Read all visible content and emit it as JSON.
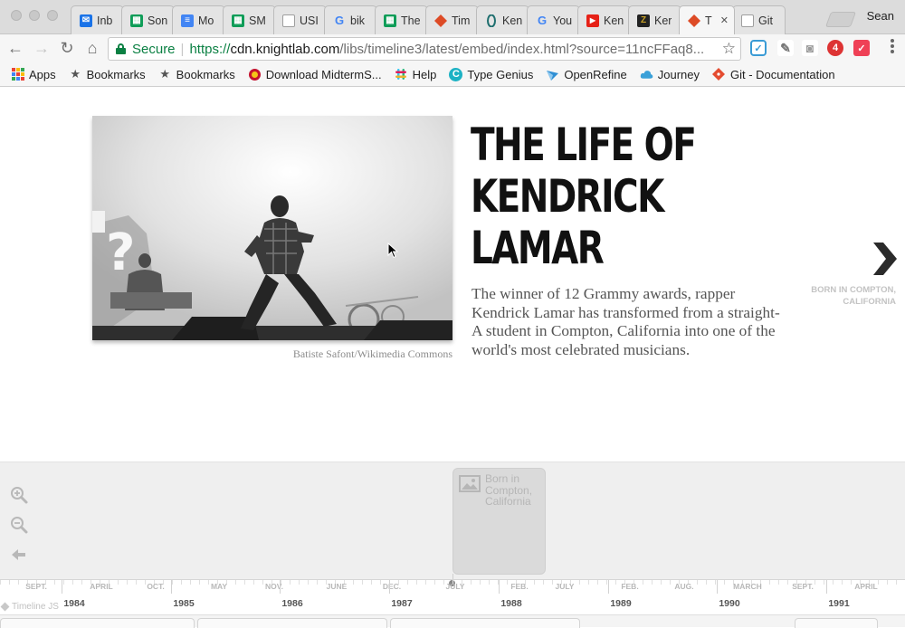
{
  "browser": {
    "tabs": [
      {
        "label": "Inb",
        "icon": "inbox-icon",
        "color": "#1a73e8"
      },
      {
        "label": "Son",
        "icon": "sheets-icon",
        "color": "#0f9d58"
      },
      {
        "label": "Mo",
        "icon": "docs-icon",
        "color": "#4285f4"
      },
      {
        "label": "SM",
        "icon": "sheets-icon",
        "color": "#0f9d58"
      },
      {
        "label": "USI",
        "icon": "page-icon",
        "color": "#9e9e9e"
      },
      {
        "label": "bik",
        "icon": "google-icon",
        "color": "#4285f4"
      },
      {
        "label": "The",
        "icon": "sheets-icon",
        "color": "#0f9d58"
      },
      {
        "label": "Tim",
        "icon": "timeline-icon",
        "color": "#dd4b26"
      },
      {
        "label": "Ken",
        "icon": "knightlab-icon",
        "color": "#1f6f6f"
      },
      {
        "label": "You",
        "icon": "google-icon",
        "color": "#4285f4"
      },
      {
        "label": "Ken",
        "icon": "youtube-icon",
        "color": "#e62117"
      },
      {
        "label": "Ker",
        "icon": "z-icon",
        "color": "#c9a227"
      },
      {
        "label": "T",
        "icon": "timeline-icon",
        "color": "#dd4b26",
        "active": true
      },
      {
        "label": "Git",
        "icon": "page-icon",
        "color": "#9e9e9e"
      }
    ],
    "profile": "Sean",
    "secure_label": "Secure",
    "url_scheme": "https://",
    "url_host": "cdn.knightlab.com",
    "url_path": "/libs/timeline3/latest/embed/index.html?source=11ncFFaq8...",
    "bookmarks": [
      {
        "label": "Apps",
        "icon": "apps-icon"
      },
      {
        "label": "Bookmarks",
        "icon": "star-icon"
      },
      {
        "label": "Bookmarks",
        "icon": "star-icon"
      },
      {
        "label": "Download MidtermS...",
        "icon": "terrapin-icon"
      },
      {
        "label": "Help",
        "icon": "slack-icon"
      },
      {
        "label": "Type Genius",
        "icon": "typegenius-icon"
      },
      {
        "label": "OpenRefine",
        "icon": "openrefine-icon"
      },
      {
        "label": "Journey",
        "icon": "cloud-icon"
      },
      {
        "label": "Git - Documentation",
        "icon": "git-icon"
      }
    ]
  },
  "slide": {
    "headline_line1": "THE LIFE OF",
    "headline_line2": "KENDRICK",
    "headline_line3": "LAMAR",
    "description": "The winner of 12 Grammy awards, rapper Kendrick Lamar has transformed from a straight-A student in Compton, California into one of the world's most celebrated musicians.",
    "photo_credit": "Batiste Safont/Wikimedia Commons",
    "next_label": "BORN IN COMPTON, CALIFORNIA"
  },
  "timeline": {
    "marker_text": "Born in Compton, California",
    "credit": "Timeline JS",
    "years": [
      "1984",
      "1985",
      "1986",
      "1987",
      "1988",
      "1989",
      "1990",
      "1991"
    ],
    "months": [
      "SEPT.",
      "APRIL",
      "OCT.",
      "MAY",
      "NOV.",
      "JUNE",
      "DEC.",
      "JULY",
      "FEB.",
      "JULY",
      "FEB.",
      "AUG.",
      "MARCH",
      "SEPT.",
      "APRIL"
    ]
  }
}
